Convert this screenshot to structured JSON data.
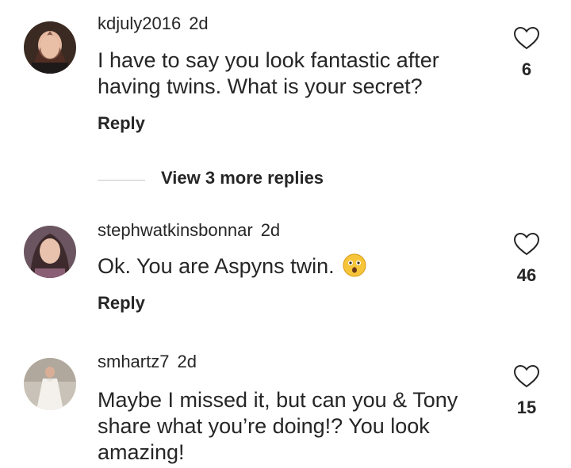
{
  "comments": [
    {
      "username": "kdjuly2016",
      "time": "2d",
      "text": "I have to say you look fantastic after having twins. What is your secret?",
      "reply_label": "Reply",
      "likes": "6"
    },
    {
      "username": "stephwatkinsbonnar",
      "time": "2d",
      "text": "Ok. You are Aspyns twin.",
      "emoji": "astonished-face",
      "reply_label": "Reply",
      "likes": "46"
    },
    {
      "username": "smhartz7",
      "time": "2d",
      "text": "Maybe I missed it, but can you & Tony share what you’re doing!? You look amazing!",
      "likes": "15"
    }
  ],
  "view_more_replies": "View 3 more replies",
  "colors": {
    "text": "#262626",
    "divider": "#c7c7c7",
    "heart_outline": "#262626"
  }
}
